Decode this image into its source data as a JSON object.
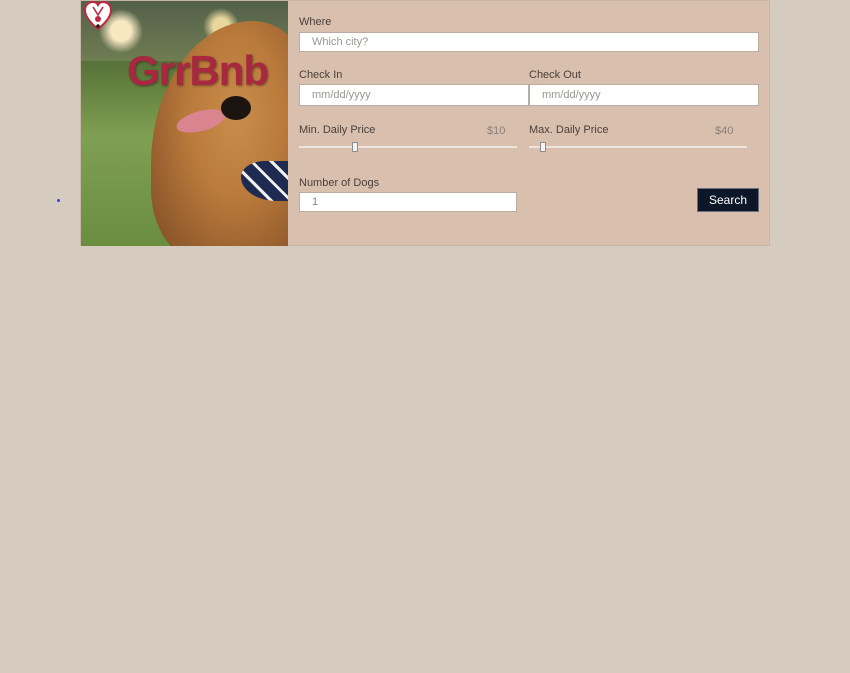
{
  "brand": {
    "name": "GrrBnb",
    "icon": "heart-dog-logo-icon"
  },
  "form": {
    "where": {
      "label": "Where",
      "placeholder": "Which city?"
    },
    "check_in": {
      "label": "Check In",
      "placeholder": "mm/dd/yyyy"
    },
    "check_out": {
      "label": "Check Out",
      "placeholder": "mm/dd/yyyy"
    },
    "min_price": {
      "label": "Min. Daily Price",
      "value": "$10"
    },
    "max_price": {
      "label": "Max. Daily Price",
      "value": "$40"
    },
    "dogs": {
      "label": "Number of Dogs",
      "value": "1"
    },
    "search_label": "Search"
  },
  "colors": {
    "page_bg": "#d5cbbf",
    "card_bg": "#d9bfae",
    "brand": "#a8283f",
    "button_bg": "#0c1728"
  }
}
